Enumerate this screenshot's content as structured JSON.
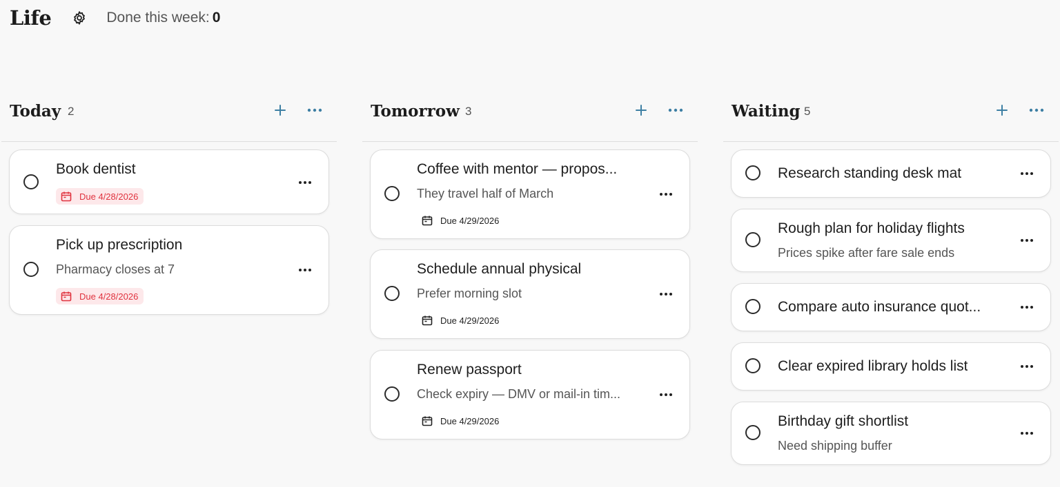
{
  "app": {
    "title": "Life"
  },
  "header": {
    "done_label": "Done this week:",
    "done_count": "0"
  },
  "colors": {
    "accent": "#3d7fa3",
    "overdue": "#e0323e",
    "overdue_bg": "#fde8ea"
  },
  "columns": [
    {
      "title": "Today",
      "count": "2",
      "cards": [
        {
          "title": "Book dentist",
          "note": "",
          "due": "Due 4/28/2026",
          "overdue": true
        },
        {
          "title": "Pick up prescription",
          "note": "Pharmacy closes at 7",
          "due": "Due 4/28/2026",
          "overdue": true
        }
      ]
    },
    {
      "title": "Tomorrow",
      "count": "3",
      "cards": [
        {
          "title": "Coffee with mentor — propos...",
          "note": "They travel half of March",
          "due": "Due 4/29/2026",
          "overdue": false
        },
        {
          "title": "Schedule annual physical",
          "note": "Prefer morning slot",
          "due": "Due 4/29/2026",
          "overdue": false
        },
        {
          "title": "Renew passport",
          "note": "Check expiry — DMV or mail-in tim...",
          "due": "Due 4/29/2026",
          "overdue": false
        }
      ]
    },
    {
      "title": "Waiting",
      "count": "5",
      "cards": [
        {
          "title": "Research standing desk mat",
          "note": "",
          "due": "",
          "overdue": false
        },
        {
          "title": "Rough plan for holiday flights",
          "note": "Prices spike after fare sale ends",
          "due": "",
          "overdue": false
        },
        {
          "title": "Compare auto insurance quot...",
          "note": "",
          "due": "",
          "overdue": false
        },
        {
          "title": "Clear expired library holds list",
          "note": "",
          "due": "",
          "overdue": false
        },
        {
          "title": "Birthday gift shortlist",
          "note": "Need shipping buffer",
          "due": "",
          "overdue": false
        }
      ]
    }
  ]
}
